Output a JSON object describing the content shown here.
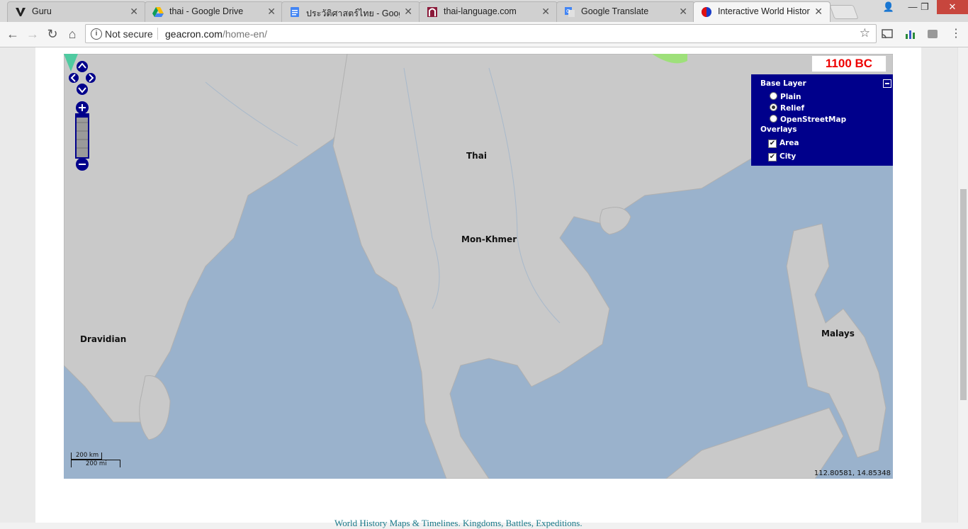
{
  "tabs": [
    {
      "title": "Guru",
      "icon": "v-logo-icon"
    },
    {
      "title": "thai - Google Drive",
      "icon": "google-drive-icon"
    },
    {
      "title": "ประวัติศาสตร์ไทย - Google",
      "icon": "google-docs-icon"
    },
    {
      "title": "thai-language.com",
      "icon": "thai-language-icon"
    },
    {
      "title": "Google Translate",
      "icon": "google-translate-icon"
    },
    {
      "title": "Interactive World History",
      "icon": "geacron-icon"
    }
  ],
  "address": {
    "security": "Not secure",
    "host": "geacron.com",
    "path": "/home-en/"
  },
  "map": {
    "date": "1100 BC",
    "layer_switcher": {
      "base_title": "Base Layer",
      "base_layers": [
        "Plain",
        "Relief",
        "OpenStreetMap"
      ],
      "selected_base": "Relief",
      "overlays_title": "Overlays",
      "overlays": [
        "Area",
        "City"
      ]
    },
    "labels": [
      "Thai",
      "Mon-Khmer",
      "Dravidian",
      "Malays"
    ],
    "scale": {
      "km": "200 km",
      "mi": "200 mi"
    },
    "coordinates": "112.80581, 14.85348",
    "colors": {
      "sea": "#9ab2cc",
      "land": "#c8c8c8",
      "panel": "#00008b",
      "date": "#e00000"
    }
  },
  "footer": {
    "text": "World History Maps & Timelines. Kingdoms, Battles, Expeditions."
  }
}
